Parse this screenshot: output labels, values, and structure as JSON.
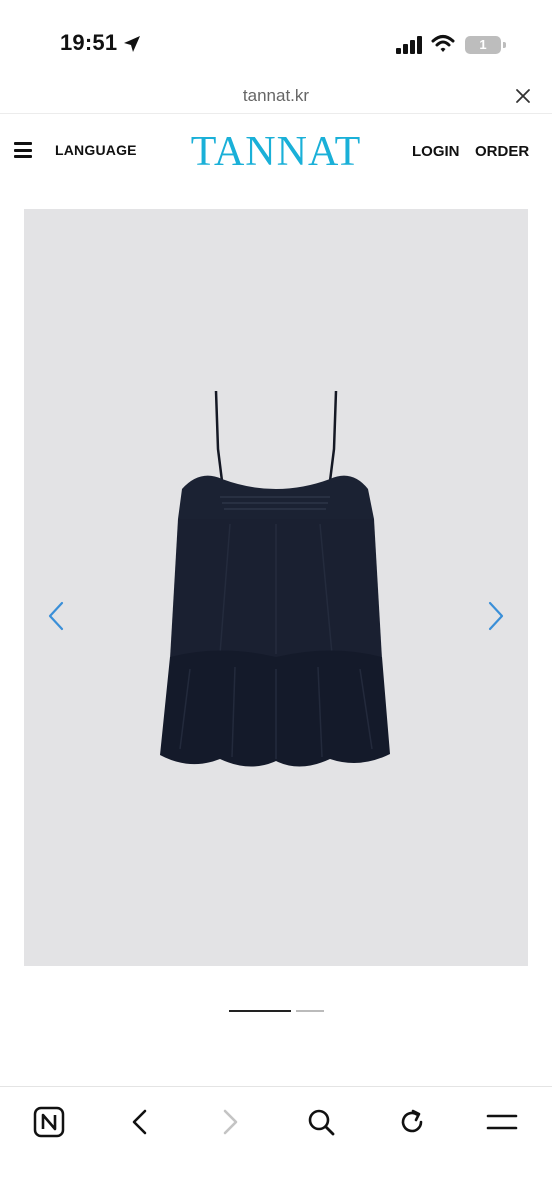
{
  "status_bar": {
    "time": "19:51",
    "battery_level": "1",
    "icons": [
      "location-arrow-icon",
      "signal-icon",
      "wifi-icon",
      "battery-icon"
    ]
  },
  "browser": {
    "url": "tannat.kr",
    "close_icon": "close-icon"
  },
  "header": {
    "menu_icon": "hamburger-menu-icon",
    "language_label": "LANGUAGE",
    "logo_text": "TANNAT",
    "login_label": "LOGIN",
    "order_label": "ORDER",
    "logo_color": "#1ab0d8"
  },
  "carousel": {
    "product": "navy sleeveless tiered mini dress",
    "background_color": "#e3e3e5",
    "arrow_color": "#3a8fd8",
    "prev_icon": "chevron-left-icon",
    "next_icon": "chevron-right-icon",
    "slide_count": 2,
    "active_slide": 1
  },
  "bottom_toolbar": {
    "items": [
      "naver-home-icon",
      "back-icon",
      "forward-icon",
      "search-icon",
      "reload-icon",
      "menu-icon"
    ]
  }
}
